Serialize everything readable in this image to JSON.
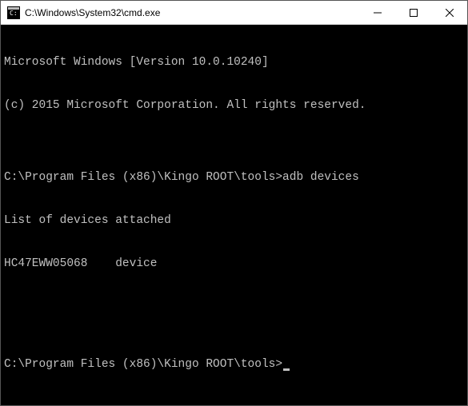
{
  "window": {
    "title": "C:\\Windows\\System32\\cmd.exe"
  },
  "terminal": {
    "lines": [
      "Microsoft Windows [Version 10.0.10240]",
      "(c) 2015 Microsoft Corporation. All rights reserved.",
      "",
      "C:\\Program Files (x86)\\Kingo ROOT\\tools>adb devices",
      "List of devices attached",
      "HC47EWW05068    device",
      "",
      "",
      "C:\\Program Files (x86)\\Kingo ROOT\\tools>"
    ]
  },
  "colors": {
    "terminal_bg": "#000000",
    "terminal_fg": "#c0c0c0",
    "titlebar_bg": "#ffffff"
  }
}
